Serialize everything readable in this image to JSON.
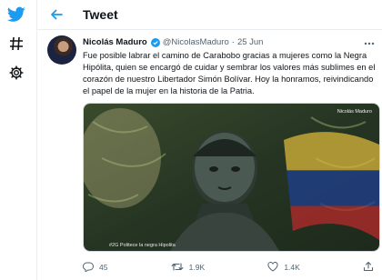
{
  "header": {
    "title": "Tweet"
  },
  "tweet": {
    "author_name": "Nicolás Maduro",
    "handle": "@NicolasMaduro",
    "separator": "·",
    "date": "25 Jun",
    "text": "Fue posible labrar el camino de Carabobo gracias a mujeres como la Negra Hipólita, quien se encargó de cuidar y sembrar los valores más sublimes en el corazón de nuestro Libertador Simón Bolívar. Hoy la honramos, reivindicando el papel de la mujer en la historia de la Patria.",
    "media": {
      "caption": "#2G Politece la negra Hipolita",
      "watermark": "Nicolás Maduro"
    },
    "stats": {
      "replies": "45",
      "retweets": "1.9K",
      "likes": "1.4K"
    }
  },
  "colors": {
    "accent": "#1d9bf0",
    "muted": "#536471",
    "border": "#ebeef0"
  },
  "icons": [
    "twitter-bird-icon",
    "hashtag-icon",
    "gear-icon",
    "back-arrow-icon",
    "verified-icon",
    "more-icon",
    "reply-icon",
    "retweet-icon",
    "heart-icon",
    "share-icon"
  ]
}
